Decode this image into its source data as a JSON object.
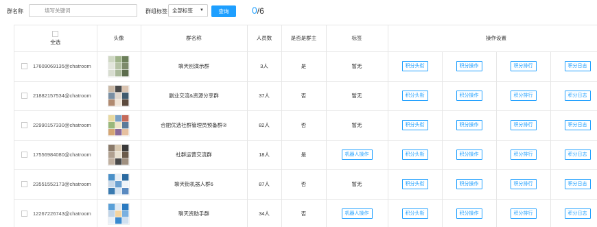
{
  "toolbar": {
    "group_name_label": "群名称",
    "search_placeholder": "填写关键词",
    "group_tag_label": "群组标签",
    "tag_select_value": "全部标签",
    "query_label": "查询",
    "selected_count": "0",
    "total_count": "/6"
  },
  "table": {
    "headers": {
      "select_all": "全选",
      "avatar": "头像",
      "group_name": "群名称",
      "member_count": "人员数",
      "is_owner": "是否是群主",
      "tag": "标签",
      "actions": "操作设置"
    },
    "action_labels": [
      "积分头衔",
      "积分操作",
      "积分排行",
      "积分日志"
    ],
    "rows": [
      {
        "id": "17609069135@chatroom",
        "name": "聊天别演示群",
        "members": "3人",
        "is_owner": "是",
        "tag": "暂无",
        "tag_is_button": false,
        "avatar_colors": [
          "#cfd8c4",
          "#9fb38a",
          "#6c7f5a",
          "#e3e6dd",
          "#b5c2a5",
          "#7d8a6b",
          "#d8ddd0",
          "#aab99a",
          "#5d6d4d"
        ]
      },
      {
        "id": "21882157534@chatroom",
        "name": "副业交流&资源分享群",
        "members": "37人",
        "is_owner": "否",
        "tag": "暂无",
        "tag_is_button": false,
        "avatar_colors": [
          "#c9b8a6",
          "#4a4a4a",
          "#d9c3b0",
          "#7a8fa3",
          "#e0d6cc",
          "#3f5a6e",
          "#b08a70",
          "#efe3d6",
          "#5c4a3d"
        ]
      },
      {
        "id": "22990157330@chatroom",
        "name": "合肥优选社群管理员预备群②",
        "members": "82人",
        "is_owner": "否",
        "tag": "暂无",
        "tag_is_button": false,
        "avatar_colors": [
          "#e8d9a0",
          "#7aa0c4",
          "#c46a5a",
          "#9ab87a",
          "#f0e6c8",
          "#5a7a9a",
          "#d4a574",
          "#8a6a9a",
          "#e6c0a0"
        ]
      },
      {
        "id": "17556984080@chatroom",
        "name": "社群运营交流群",
        "members": "18人",
        "is_owner": "是",
        "tag": "机器人操作",
        "tag_is_button": true,
        "avatar_colors": [
          "#8a7a6a",
          "#d8c8b0",
          "#3a3a3a",
          "#b0a090",
          "#e8e0d0",
          "#6a5a4a",
          "#c0b0a0",
          "#4a4a4a",
          "#a09080"
        ]
      },
      {
        "id": "23551552173@chatroom",
        "name": "聊天街机器人群6",
        "members": "87人",
        "is_owner": "否",
        "tag": "暂无",
        "tag_is_button": false,
        "avatar_colors": [
          "#4a90c8",
          "#e8eef4",
          "#2a6aa0",
          "#c8d8e8",
          "#6aa0d0",
          "#f0f4f8",
          "#3a7ab0",
          "#d8e4f0",
          "#5a8ac0"
        ]
      },
      {
        "id": "12267226743@chatroom",
        "name": "聊天资助手群",
        "members": "34人",
        "is_owner": "否",
        "tag": "机器人操作",
        "tag_is_button": true,
        "avatar_colors": [
          "#5aa0d8",
          "#e0eaf4",
          "#2a7ac0",
          "#c0d4e8",
          "#f4d4a0",
          "#7ab0e0",
          "#e8f0f8",
          "#3a8ad0",
          "#d0e0f0"
        ]
      }
    ]
  }
}
